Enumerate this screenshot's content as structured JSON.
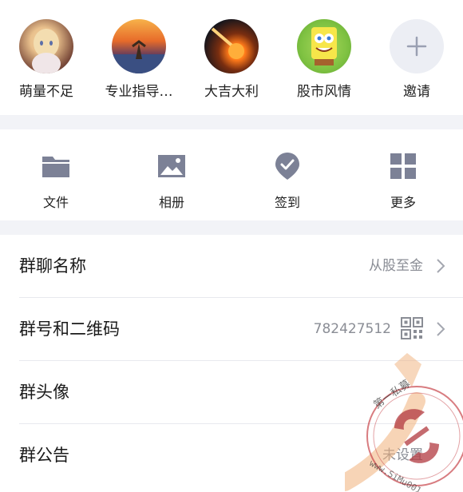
{
  "members": [
    {
      "name": "萌量不足"
    },
    {
      "name": "专业指导…"
    },
    {
      "name": "大吉大利"
    },
    {
      "name": "股市风情"
    }
  ],
  "invite": {
    "label": "邀请"
  },
  "tools": [
    {
      "label": "文件",
      "icon": "folder-icon"
    },
    {
      "label": "相册",
      "icon": "image-icon"
    },
    {
      "label": "签到",
      "icon": "location-check-icon"
    },
    {
      "label": "更多",
      "icon": "grid-icon"
    }
  ],
  "settings": {
    "group_name": {
      "title": "群聊名称",
      "value": "从股至金"
    },
    "group_id": {
      "title": "群号和二维码",
      "value": "782427512"
    },
    "group_avatar": {
      "title": "群头像"
    },
    "group_notice": {
      "title": "群公告",
      "value": "未设置"
    }
  },
  "watermark": {
    "site": "www.SiMu001.cn",
    "text": "第一私募"
  },
  "colors": {
    "accent_icon": "#7c8196",
    "divider": "#e8e9ee",
    "page_bg": "#f2f3f7"
  }
}
